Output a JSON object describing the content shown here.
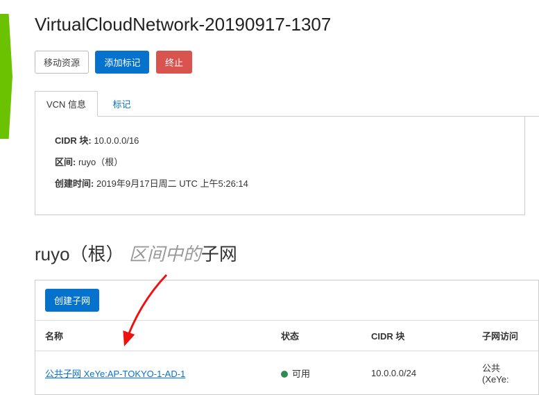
{
  "header": {
    "title": "VirtualCloudNetwork-20190917-1307"
  },
  "toolbar": {
    "move_label": "移动资源",
    "add_tag_label": "添加标记",
    "terminate_label": "终止"
  },
  "tabs": {
    "info_label": "VCN 信息",
    "tags_label": "标记"
  },
  "info": {
    "cidr_label": "CIDR 块:",
    "cidr_value": "10.0.0.0/16",
    "compartment_label": "区间:",
    "compartment_value": "ruyo（根）",
    "created_label": "创建时间:",
    "created_value": "2019年9月17日周二 UTC 上午5:26:14"
  },
  "section": {
    "compartment": "ruyo（根）",
    "in_text": "区间中的",
    "resource": "子网"
  },
  "subnets": {
    "create_label": "创建子网",
    "columns": {
      "name": "名称",
      "status": "状态",
      "cidr": "CIDR 块",
      "access": "子网访问"
    },
    "rows": [
      {
        "name": "公共子网 XeYe:AP-TOKYO-1-AD-1",
        "status": "可用",
        "cidr": "10.0.0.0/24",
        "access": "公共 (XeYe:"
      }
    ]
  }
}
